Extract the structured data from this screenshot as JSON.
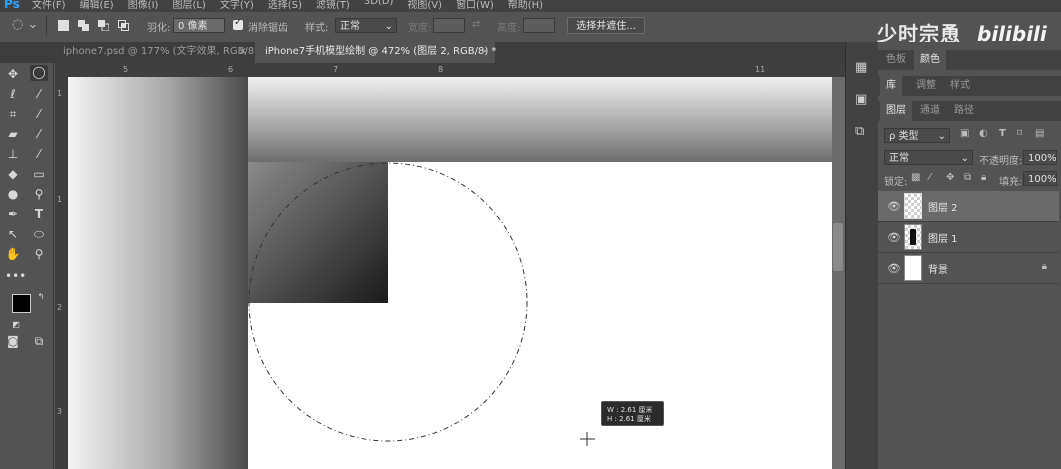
{
  "menubar": {
    "items": [
      "文件(F)",
      "编辑(E)",
      "图像(I)",
      "图层(L)",
      "文字(Y)",
      "选择(S)",
      "滤镜(T)",
      "3D(D)",
      "视图(V)",
      "窗口(W)",
      "帮助(H)"
    ]
  },
  "options": {
    "feather_label": "羽化:",
    "feather_value": "0 像素",
    "antialias_label": "消除锯齿",
    "style_label": "样式:",
    "style_value": "正常",
    "width_label": "宽度:",
    "height_label": "高度:",
    "select_mask_label": "选择并遮住..."
  },
  "branding": {
    "text": "少时宗恿",
    "logo": "bilibili"
  },
  "tabs": [
    {
      "label": "iphone7.psd @ 177% (文字效果, RGB/8)"
    },
    {
      "label": "iPhone7手机模型绘制 @ 472% (图层 2, RGB/8) *"
    }
  ],
  "ruler": {
    "top": [
      "5",
      "6",
      "7",
      "8",
      "11"
    ],
    "left": [
      "1",
      "1",
      "2",
      "3"
    ]
  },
  "measure": {
    "w": "W : 2.61 厘米",
    "h": "H : 2.61 厘米"
  },
  "panel": {
    "group1_tabs": [
      "色板",
      "颜色"
    ],
    "group2_tabs": [
      "库",
      "调整",
      "样式"
    ],
    "group3_tabs": [
      "图层",
      "通道",
      "路径"
    ],
    "filter_type": "ρ 类型",
    "blend_mode": "正常",
    "opacity_label": "不透明度:",
    "opacity_value": "100%",
    "lock_label": "锁定:",
    "fill_label": "填充:",
    "fill_value": "100%",
    "layers": [
      {
        "name": "图层 2",
        "selected": true
      },
      {
        "name": "图层 1",
        "selected": false
      },
      {
        "name": "背景",
        "selected": false
      }
    ]
  },
  "colors": {
    "accent": "#2fa4ff",
    "canvas_bg": "#ffffff",
    "ui_bg": "#535353"
  }
}
